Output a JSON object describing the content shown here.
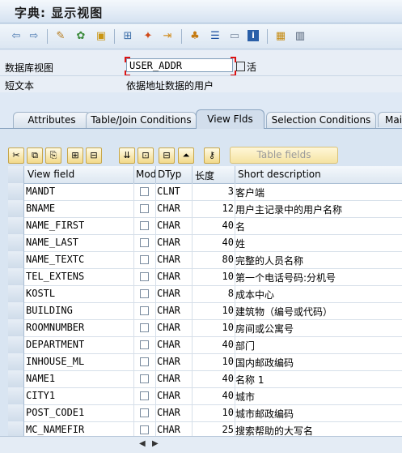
{
  "window": {
    "title": "字典: 显示视图"
  },
  "toolbar": {
    "icons": [
      "back-icon",
      "forward-icon",
      "display-change-icon",
      "other-object-icon",
      "activate-icon",
      "where-used-icon",
      "object-list-icon",
      "navigate-icon",
      "hierarchy-icon",
      "technical-settings-icon",
      "display-object-icon",
      "info-icon",
      "layout-icon",
      "table-icon"
    ]
  },
  "form": {
    "view_label": "数据库视图",
    "view_value": "USER_ADDR",
    "active_label": "活",
    "short_text_label": "短文本",
    "short_text_value": "依据地址数据的用户"
  },
  "tabs": [
    {
      "label": "Attributes",
      "active": false
    },
    {
      "label": "Table/Join Conditions",
      "active": false
    },
    {
      "label": "View Flds",
      "active": true
    },
    {
      "label": "Selection Conditions",
      "active": false
    },
    {
      "label": "Mai",
      "active": false
    }
  ],
  "table_fields_button": "Table fields",
  "columns": {
    "view_field": "View field",
    "mod": "Mod",
    "dtyp": "DTyp",
    "length": "长度",
    "short_desc": "Short description"
  },
  "rows": [
    {
      "field": "MANDT",
      "dtyp": "CLNT",
      "len": "3",
      "desc": "客户端"
    },
    {
      "field": "BNAME",
      "dtyp": "CHAR",
      "len": "12",
      "desc": "用户主记录中的用户名称"
    },
    {
      "field": "NAME_FIRST",
      "dtyp": "CHAR",
      "len": "40",
      "desc": "名"
    },
    {
      "field": "NAME_LAST",
      "dtyp": "CHAR",
      "len": "40",
      "desc": "姓"
    },
    {
      "field": "NAME_TEXTC",
      "dtyp": "CHAR",
      "len": "80",
      "desc": "完整的人员名称"
    },
    {
      "field": "TEL_EXTENS",
      "dtyp": "CHAR",
      "len": "10",
      "desc": "第一个电话号码:分机号"
    },
    {
      "field": "KOSTL",
      "dtyp": "CHAR",
      "len": "8",
      "desc": "成本中心"
    },
    {
      "field": "BUILDING",
      "dtyp": "CHAR",
      "len": "10",
      "desc": "建筑物（编号或代码）"
    },
    {
      "field": "ROOMNUMBER",
      "dtyp": "CHAR",
      "len": "10",
      "desc": "房间或公寓号"
    },
    {
      "field": "DEPARTMENT",
      "dtyp": "CHAR",
      "len": "40",
      "desc": "部门"
    },
    {
      "field": "INHOUSE_ML",
      "dtyp": "CHAR",
      "len": "10",
      "desc": "国内邮政编码"
    },
    {
      "field": "NAME1",
      "dtyp": "CHAR",
      "len": "40",
      "desc": "名称 1"
    },
    {
      "field": "CITY1",
      "dtyp": "CHAR",
      "len": "40",
      "desc": "城市"
    },
    {
      "field": "POST_CODE1",
      "dtyp": "CHAR",
      "len": "10",
      "desc": "城市邮政编码"
    },
    {
      "field": "MC_NAMEFIR",
      "dtyp": "CHAR",
      "len": "25",
      "desc": "搜索帮助的大写名"
    }
  ]
}
